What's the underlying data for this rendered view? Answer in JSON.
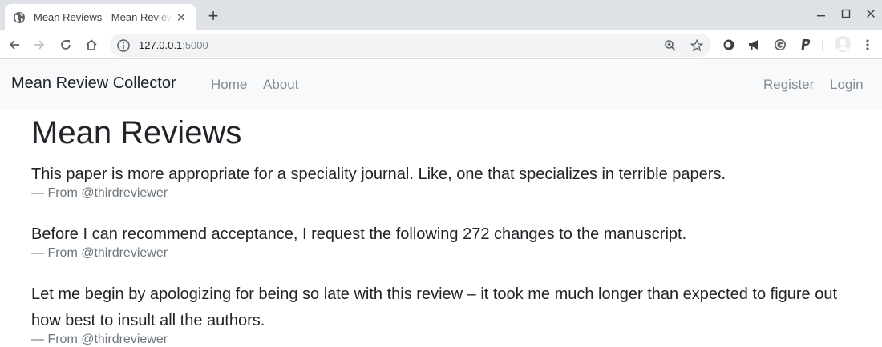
{
  "browser": {
    "tab_title": "Mean Reviews - Mean Review Collector",
    "url_host": "127.0.0.1",
    "url_port": ":5000"
  },
  "navbar": {
    "brand": "Mean Review Collector",
    "left_links": [
      "Home",
      "About"
    ],
    "right_links": [
      "Register",
      "Login"
    ]
  },
  "main": {
    "title": "Mean Reviews",
    "reviews": [
      {
        "text": "This paper is more appropriate for a speciality journal. Like, one that specializes in terrible papers.",
        "footer": "— From @thirdreviewer"
      },
      {
        "text": "Before I can recommend acceptance, I request the following 272 changes to the manuscript.",
        "footer": "— From @thirdreviewer"
      },
      {
        "text": "Let me begin by apologizing for being so late with this review – it took me much longer than expected to figure out how best to insult all the authors.",
        "footer": "— From @thirdreviewer"
      }
    ]
  },
  "icons": {
    "favicon": "globe-icon",
    "extensions": [
      "circle-extension-icon",
      "megaphone-extension-icon",
      "grammar-extension-icon",
      "paypal-extension-icon"
    ]
  },
  "colors": {
    "tabstrip": "#dee1e6",
    "navbar_bg": "#f8f9fa",
    "nav_link": "#858b91",
    "footer_text": "#6c757d"
  }
}
